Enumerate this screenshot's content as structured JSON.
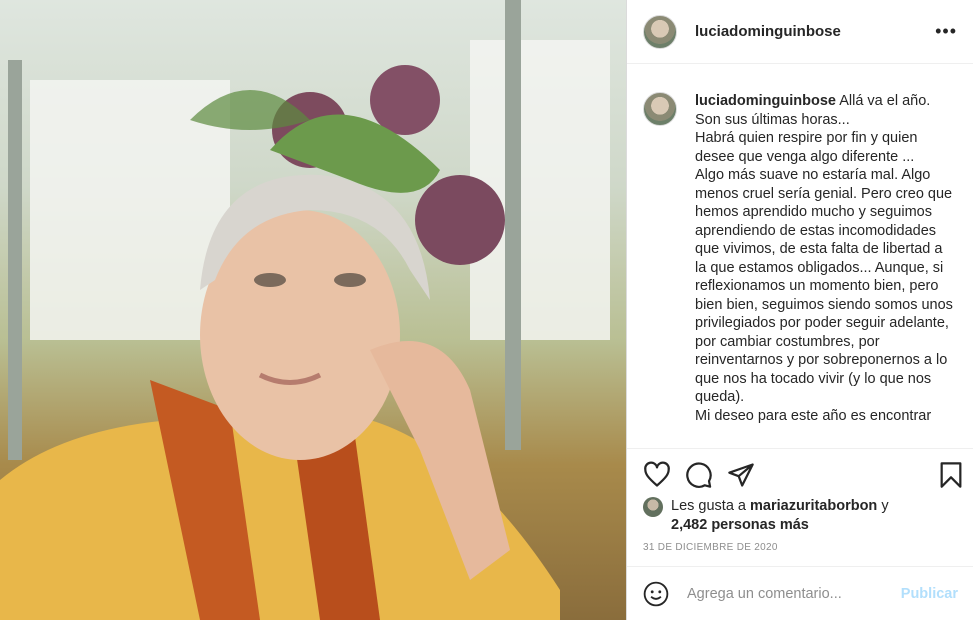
{
  "post": {
    "username": "luciadominguinbose",
    "caption_username": "luciadominguinbose",
    "caption_text": " Allá va el año. Son sus últimas horas...\nHabrá quien respire por fin y quien desee que venga algo diferente ...\nAlgo más suave no estaría mal. Algo menos cruel sería genial. Pero creo que hemos aprendido mucho y seguimos aprendiendo de estas incomodidades que vivimos, de esta falta de libertad a la que estamos obligados... Aunque, si reflexionamos un momento bien, pero bien bien, seguimos siendo somos unos privilegiados por poder seguir adelante, por cambiar costumbres, por reinventarnos y por sobreponernos a lo que nos ha tocado vivir (y lo que nos queda).\nMi deseo para este año es encontrar",
    "more_icon": "more-dots-icon",
    "likes_prefix": "Les gusta a ",
    "likes_user": "mariazuritaborbon",
    "likes_and": " y",
    "likes_count": "2,482 personas más",
    "date": "31 DE DICIEMBRE DE 2020"
  },
  "actions": {
    "icons": [
      "heart-icon",
      "comment-icon",
      "share-icon",
      "bookmark-icon"
    ]
  },
  "comment_box": {
    "placeholder": "Agrega un comentario...",
    "publish_label": "Publicar",
    "emoji_icon": "emoji-icon"
  },
  "colors": {
    "accent_disabled": "#b2dffc",
    "text": "#262626",
    "muted": "#8e8e8e"
  }
}
